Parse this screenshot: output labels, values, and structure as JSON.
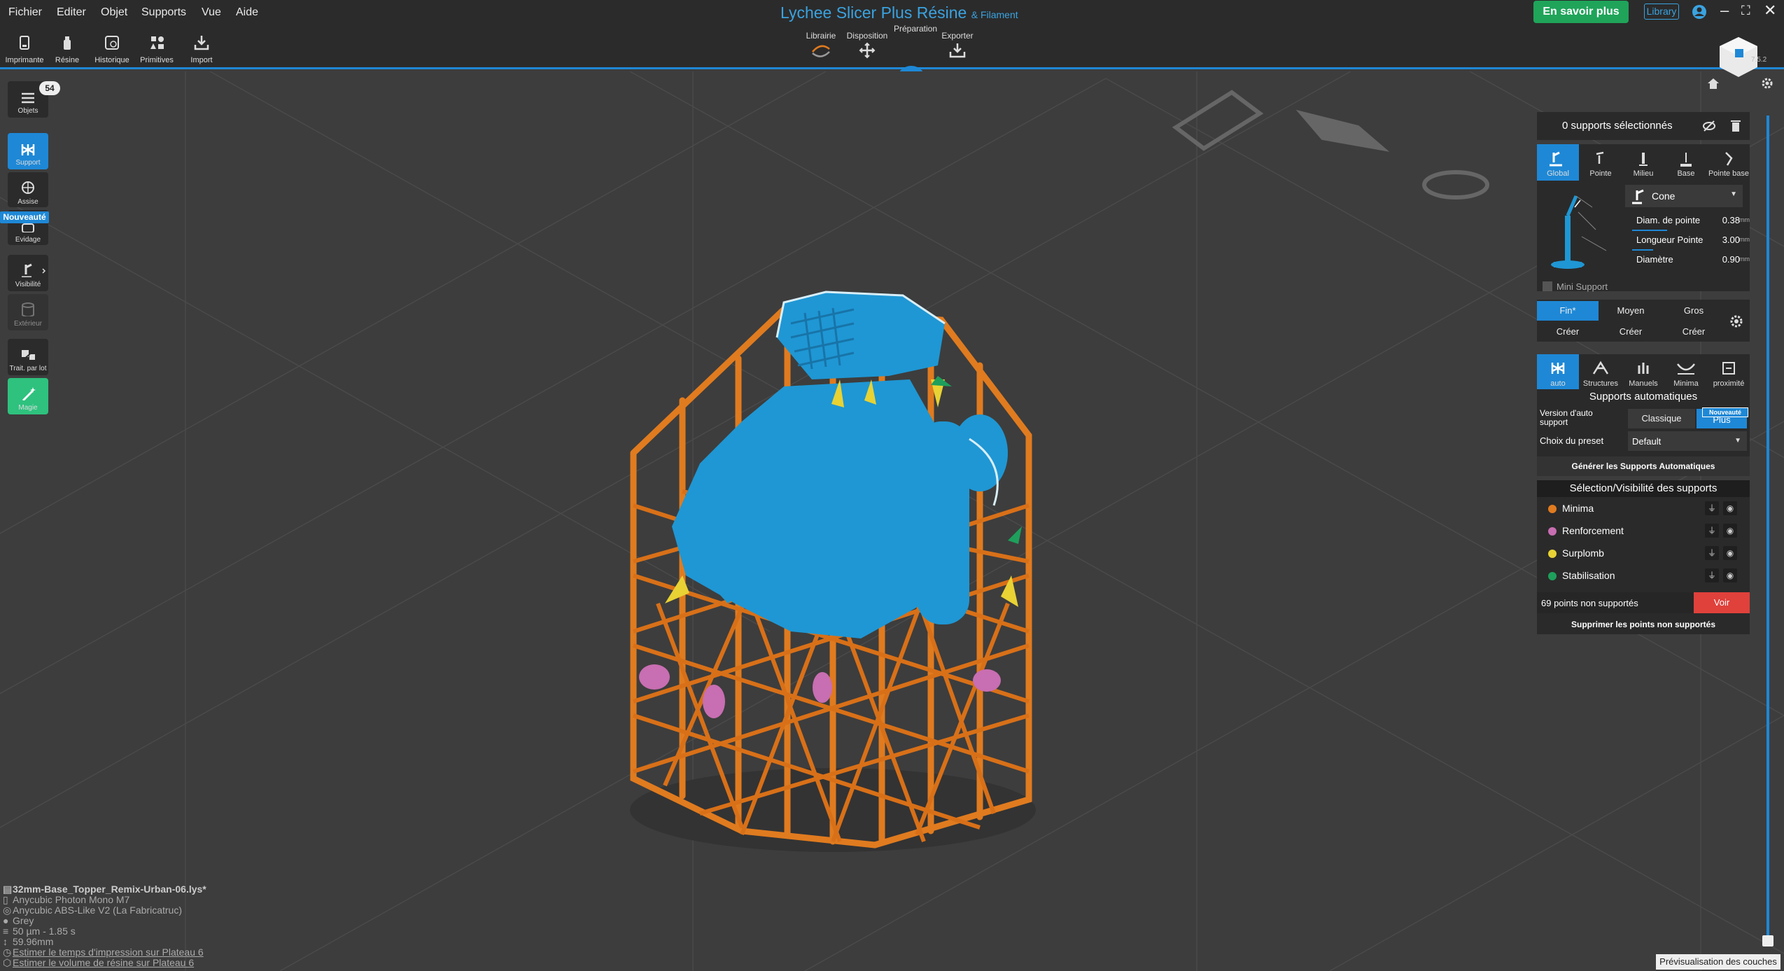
{
  "menu": [
    "Fichier",
    "Editer",
    "Objet",
    "Supports",
    "Vue",
    "Aide"
  ],
  "title": {
    "main": "Lychee Slicer Plus Résine",
    "sub": "& Filament"
  },
  "header_buttons": {
    "learn_more": "En savoir plus",
    "library": "Library"
  },
  "version": "7.5.2",
  "toolbar": [
    "Imprimante",
    "Résine",
    "Historique",
    "Primitives",
    "Import"
  ],
  "modes": {
    "library": "Librairie",
    "layout": "Disposition",
    "preparation": "Préparation",
    "export": "Exporter"
  },
  "sidebar": {
    "objects": "Objets",
    "objects_count": "54",
    "support": "Support",
    "seat": "Assise",
    "new_badge": "Nouveauté",
    "hollow": "Evidage",
    "visibility": "Visibilité",
    "exterior": "Extérieur",
    "batch": "Trait. par lot",
    "magic": "Magie"
  },
  "panel": {
    "selected": "0 supports sélectionnés",
    "tip_tabs": [
      "Global",
      "Pointe",
      "Milieu",
      "Base",
      "Pointe base"
    ],
    "tip_type": "Cone",
    "params": [
      {
        "name": "Diam. de pointe",
        "value": "0.38",
        "unit": "mm"
      },
      {
        "name": "Longueur Pointe",
        "value": "3.00",
        "unit": "mm"
      },
      {
        "name": "Diamètre",
        "value": "0.90",
        "unit": "mm"
      }
    ],
    "mini_support": "Mini Support",
    "sizes": [
      "Fin*",
      "Moyen",
      "Gros"
    ],
    "create": "Créer",
    "auto_tabs": [
      "auto",
      "Structures",
      "Manuels",
      "Minima",
      "proximité"
    ],
    "auto_title": "Supports automatiques",
    "auto_version_label": "Version d'auto support",
    "auto_version_options": [
      "Classique",
      "Plus"
    ],
    "new_badge": "Nouveauté",
    "preset_label": "Choix du preset",
    "preset_value": "Default",
    "generate": "Générer les Supports Automatiques",
    "visibility_title": "Sélection/Visibilité des supports",
    "visibility_rows": [
      {
        "label": "Minima",
        "color": "#e07b1f"
      },
      {
        "label": "Renforcement",
        "color": "#c86eb2"
      },
      {
        "label": "Surplomb",
        "color": "#e8d234"
      },
      {
        "label": "Stabilisation",
        "color": "#1e9f5b"
      }
    ],
    "unsupported": "69 points non supportés",
    "see": "Voir",
    "delete_unsupported": "Supprimer les points non supportés"
  },
  "info": {
    "file": "32mm-Base_Topper_Remix-Urban-06.lys*",
    "printer": "Anycubic Photon Mono M7",
    "resin": "Anycubic ABS-Like V2 (La Fabricatruc)",
    "color": "Grey",
    "layer": "50 µm - 1.85 s",
    "height": "59.96mm",
    "estimate_time": "Estimer le temps d'impression sur Plateau 6",
    "estimate_volume": "Estimer le volume de résine sur Plateau 6"
  },
  "layer_preview": "Prévisualisation des couches"
}
